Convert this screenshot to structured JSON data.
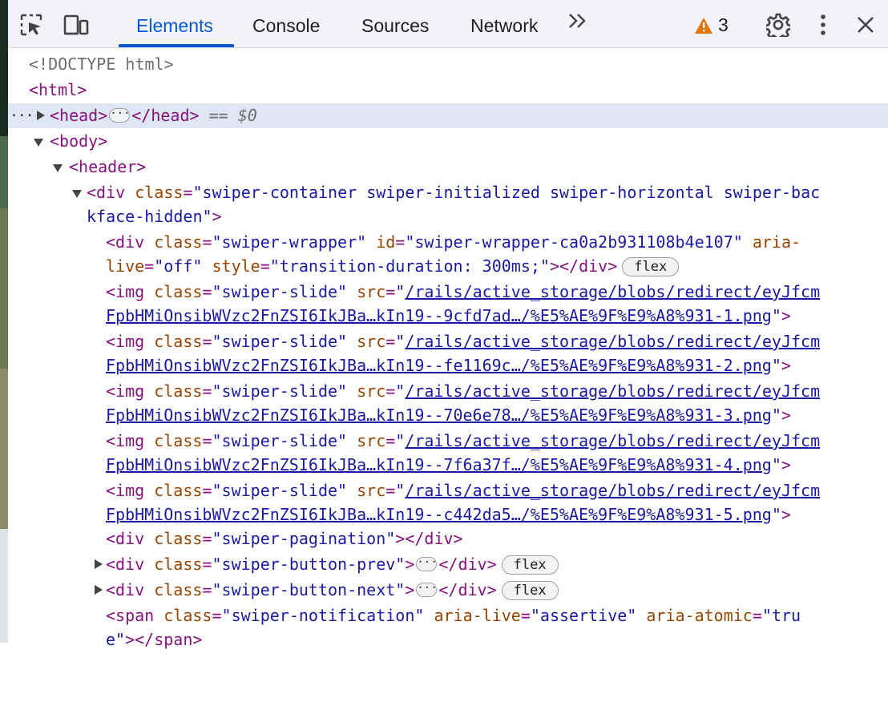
{
  "toolbar": {
    "tabs": [
      {
        "label": "Elements",
        "active": true
      },
      {
        "label": "Console",
        "active": false
      },
      {
        "label": "Sources",
        "active": false
      },
      {
        "label": "Network",
        "active": false
      }
    ],
    "more_tabs_label": ">>",
    "warning_count": "3",
    "accent_color": "#0b57d0",
    "warning_color": "#e37400",
    "icons": [
      "inspect-element-icon",
      "device-toolbar-icon",
      "warning-icon",
      "settings-gear-icon",
      "more-vertical-icon",
      "close-icon"
    ]
  },
  "dom": {
    "doctype": "<!DOCTYPE html>",
    "html_open": "<html>",
    "head_open": "<head>",
    "head_close": "</head>",
    "selected_marker": "== $0",
    "body_open": "<body>",
    "header_open": "<header>",
    "container_line1": "class=\"swiper-container swiper-initialized swiper-horizontal swiper-bac",
    "container_line2": "kface-hidden\">",
    "wrapper_line1_class": "swiper-wrapper",
    "wrapper_line1_id": "swiper-wrapper-ca0a2b931108b4e107",
    "wrapper_line2_live": "off",
    "wrapper_line2_style": "transition-duration: 300ms;",
    "flex_badge": "flex",
    "slides": [
      {
        "src1": "/rails/active_storage/blobs/redirect/eyJfcm",
        "src2": "FpbHMiOnsibWVzc2FnZSI6IkJBa…kIn19--9cfd7ad…/%E5%AE%9F%E9%A8%931-1.png"
      },
      {
        "src1": "/rails/active_storage/blobs/redirect/eyJfcm",
        "src2": "FpbHMiOnsibWVzc2FnZSI6IkJBa…kIn19--fe1169c…/%E5%AE%9F%E9%A8%931-2.png"
      },
      {
        "src1": "/rails/active_storage/blobs/redirect/eyJfcm",
        "src2": "FpbHMiOnsibWVzc2FnZSI6IkJBa…kIn19--70e6e78…/%E5%AE%9F%E9%A8%931-3.png"
      },
      {
        "src1": "/rails/active_storage/blobs/redirect/eyJfcm",
        "src2": "FpbHMiOnsibWVzc2FnZSI6IkJBa…kIn19--7f6a37f…/%E5%AE%9F%E9%A8%931-4.png"
      },
      {
        "src1": "/rails/active_storage/blobs/redirect/eyJfcm",
        "src2": "FpbHMiOnsibWVzc2FnZSI6IkJBa…kIn19--c442da5…/%E5%AE%9F%E9%A8%931-5.png"
      }
    ],
    "slide_class": "swiper-slide",
    "pagination_class": "swiper-pagination",
    "prev_class": "swiper-button-prev",
    "next_class": "swiper-button-next",
    "notification_class": "swiper-notification",
    "notification_live": "assertive",
    "notification_atomic_1": "tru",
    "notification_atomic_2": "e"
  }
}
